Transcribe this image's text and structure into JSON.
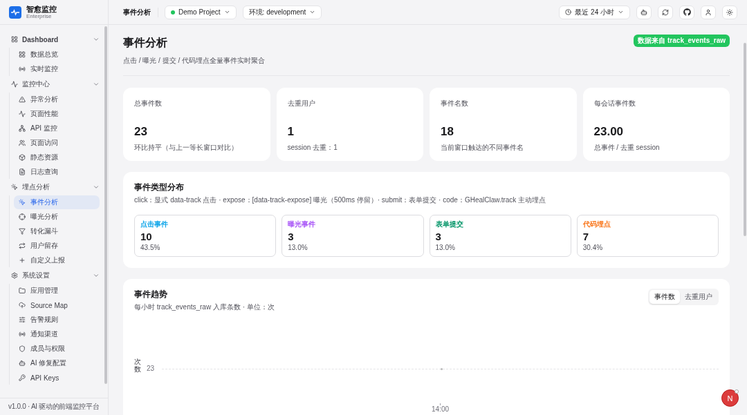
{
  "brand": {
    "name": "智愈监控",
    "edition": "Enterprise"
  },
  "sidebar": {
    "groups": [
      {
        "label": "Dashboard",
        "expanded": true,
        "children": [
          {
            "label": "数据总览",
            "selected": false
          },
          {
            "label": "实时监控",
            "selected": false
          }
        ]
      },
      {
        "label": "监控中心",
        "expanded": true,
        "children": [
          {
            "label": "异常分析",
            "selected": false
          },
          {
            "label": "页面性能",
            "selected": false
          },
          {
            "label": "API 监控",
            "selected": false
          },
          {
            "label": "页面访问",
            "selected": false
          },
          {
            "label": "静态资源",
            "selected": false
          },
          {
            "label": "日志查询",
            "selected": false
          }
        ]
      },
      {
        "label": "埋点分析",
        "expanded": true,
        "children": [
          {
            "label": "事件分析",
            "selected": true
          },
          {
            "label": "曝光分析",
            "selected": false
          },
          {
            "label": "转化漏斗",
            "selected": false
          },
          {
            "label": "用户留存",
            "selected": false
          },
          {
            "label": "自定义上报",
            "selected": false
          }
        ]
      },
      {
        "label": "系统设置",
        "expanded": true,
        "children": [
          {
            "label": "应用管理",
            "selected": false
          },
          {
            "label": "Source Map",
            "selected": false
          },
          {
            "label": "告警规则",
            "selected": false
          },
          {
            "label": "通知渠道",
            "selected": false
          },
          {
            "label": "成员与权限",
            "selected": false
          },
          {
            "label": "AI 修复配置",
            "selected": false
          },
          {
            "label": "API Keys",
            "selected": false
          }
        ]
      }
    ],
    "footer": "v1.0.0 · AI 驱动的前端监控平台"
  },
  "topbar": {
    "title": "事件分析",
    "project": "Demo Project",
    "environment": "环境: development",
    "time_range": "最近 24 小时"
  },
  "page": {
    "title": "事件分析",
    "subtitle": "点击 / 曝光 / 提交 / 代码埋点全量事件实时聚合",
    "badge": "数据来自 track_events_raw"
  },
  "stats": [
    {
      "label": "总事件数",
      "value": "23",
      "note": "环比持平（与上一等长窗口对比）"
    },
    {
      "label": "去重用户",
      "value": "1",
      "note": "session 去重：1"
    },
    {
      "label": "事件名数",
      "value": "18",
      "note": "当前窗口触达的不同事件名"
    },
    {
      "label": "每会话事件数",
      "value": "23.00",
      "note": "总事件 / 去重 session"
    }
  ],
  "distribution": {
    "title": "事件类型分布",
    "description": "click：显式 data-track 点击 · expose：[data-track-expose] 曝光（500ms 停留）· submit：表单提交 · code：GHealClaw.track 主动埋点",
    "items": [
      {
        "label": "点击事件",
        "value": "10",
        "share": "43.5%",
        "color": "#0ea5e9"
      },
      {
        "label": "曝光事件",
        "value": "3",
        "share": "13.0%",
        "color": "#a855f7"
      },
      {
        "label": "表单提交",
        "value": "3",
        "share": "13.0%",
        "color": "#059669"
      },
      {
        "label": "代码埋点",
        "value": "7",
        "share": "30.4%",
        "color": "#f97316"
      }
    ]
  },
  "trend": {
    "title": "事件趋势",
    "subtitle": "每小时 track_events_raw 入库条数 · 单位：次",
    "tabs": [
      {
        "label": "事件数",
        "selected": true
      },
      {
        "label": "去重用户",
        "selected": false
      }
    ],
    "chart": {
      "y_axis_label": "次数",
      "y_tick": "23",
      "x_tick": "14:00"
    }
  },
  "assistant": {
    "label": "N"
  }
}
